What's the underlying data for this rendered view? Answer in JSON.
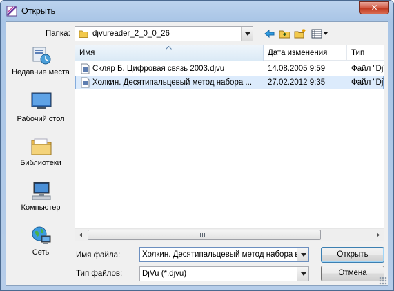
{
  "window": {
    "title": "Открыть",
    "close_label": "✕"
  },
  "toolbar": {
    "folder_label": "Папка:",
    "folder_value": "djvureader_2_0_0_26"
  },
  "sidebar": {
    "items": [
      {
        "label": "Недавние места",
        "icon": "recent-places-icon"
      },
      {
        "label": "Рабочий стол",
        "icon": "desktop-icon"
      },
      {
        "label": "Библиотеки",
        "icon": "libraries-icon"
      },
      {
        "label": "Компьютер",
        "icon": "computer-icon"
      },
      {
        "label": "Сеть",
        "icon": "network-icon"
      }
    ]
  },
  "filelist": {
    "columns": {
      "name": "Имя",
      "date": "Дата изменения",
      "type": "Тип"
    },
    "files": [
      {
        "name": "Скляр Б. Цифровая связь 2003.djvu",
        "date": "14.08.2005 9:59",
        "type": "Файл \"DjVu\"",
        "selected": false
      },
      {
        "name": "Холкин. Десятипальцевый метод набора ...",
        "date": "27.02.2012 9:35",
        "type": "Файл \"DjVu\"",
        "selected": true
      }
    ]
  },
  "bottom": {
    "filename_label": "Имя файла:",
    "filename_value": "Холкин. Десятипальцевый метод набора вслепую.djvu",
    "filetype_label": "Тип файлов:",
    "filetype_value": "DjVu (*.djvu)",
    "open_label": "Открыть",
    "cancel_label": "Отмена"
  },
  "colors": {
    "selection": "#dcebfc",
    "selection_border": "#84acdd",
    "title_bar": "#bcd3ee"
  }
}
